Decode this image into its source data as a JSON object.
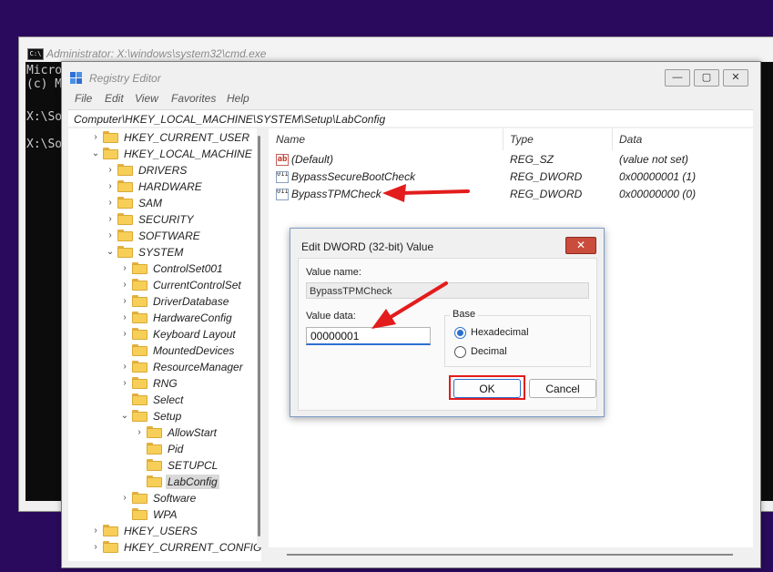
{
  "cmd": {
    "title": "Administrator: X:\\windows\\system32\\cmd.exe",
    "icon": "C:\\",
    "lines": [
      "Micro",
      "(c) M",
      "",
      "X:\\So",
      "",
      "X:\\So"
    ]
  },
  "regedit": {
    "title": "Registry Editor",
    "window_buttons": {
      "minimize": "—",
      "maximize": "▢",
      "close": "✕"
    },
    "menu": [
      "File",
      "Edit",
      "View",
      "Favorites",
      "Help"
    ],
    "address": "Computer\\HKEY_LOCAL_MACHINE\\SYSTEM\\Setup\\LabConfig",
    "tree": [
      {
        "label": "HKEY_CURRENT_USER",
        "arrow": "›"
      },
      {
        "label": "HKEY_LOCAL_MACHINE",
        "arrow": "⌄"
      },
      {
        "label": "DRIVERS",
        "arrow": "›"
      },
      {
        "label": "HARDWARE",
        "arrow": "›"
      },
      {
        "label": "SAM",
        "arrow": "›"
      },
      {
        "label": "SECURITY",
        "arrow": "›"
      },
      {
        "label": "SOFTWARE",
        "arrow": "›"
      },
      {
        "label": "SYSTEM",
        "arrow": "⌄"
      },
      {
        "label": "ControlSet001",
        "arrow": "›"
      },
      {
        "label": "CurrentControlSet",
        "arrow": "›"
      },
      {
        "label": "DriverDatabase",
        "arrow": "›"
      },
      {
        "label": "HardwareConfig",
        "arrow": "›"
      },
      {
        "label": "Keyboard Layout",
        "arrow": "›"
      },
      {
        "label": "MountedDevices",
        "arrow": ""
      },
      {
        "label": "ResourceManager",
        "arrow": "›"
      },
      {
        "label": "RNG",
        "arrow": "›"
      },
      {
        "label": "Select",
        "arrow": ""
      },
      {
        "label": "Setup",
        "arrow": "⌄"
      },
      {
        "label": "AllowStart",
        "arrow": "›"
      },
      {
        "label": "Pid",
        "arrow": ""
      },
      {
        "label": "SETUPCL",
        "arrow": ""
      },
      {
        "label": "LabConfig",
        "arrow": ""
      },
      {
        "label": "Software",
        "arrow": "›"
      },
      {
        "label": "WPA",
        "arrow": ""
      },
      {
        "label": "HKEY_USERS",
        "arrow": "›"
      },
      {
        "label": "HKEY_CURRENT_CONFIG",
        "arrow": "›"
      }
    ],
    "selected_key": "LabConfig",
    "columns": [
      "Name",
      "Type",
      "Data"
    ],
    "values": [
      {
        "icon": "ab",
        "name": "(Default)",
        "type": "REG_SZ",
        "data": "(value not set)"
      },
      {
        "icon": "011",
        "name": "BypassSecureBootCheck",
        "type": "REG_DWORD",
        "data": "0x00000001 (1)"
      },
      {
        "icon": "011",
        "name": "BypassTPMCheck",
        "type": "REG_DWORD",
        "data": "0x00000000 (0)"
      }
    ]
  },
  "dialog": {
    "title": "Edit DWORD (32-bit) Value",
    "close": "✕",
    "value_name_label": "Value name:",
    "value_name": "BypassTPMCheck",
    "value_data_label": "Value data:",
    "value_data": "00000001",
    "base_label": "Base",
    "base_options": [
      "Hexadecimal",
      "Decimal"
    ],
    "base_selected": "Hexadecimal",
    "ok": "OK",
    "cancel": "Cancel"
  },
  "annotations": {
    "arrow_color": "#e31c1c",
    "highlight_color": "#e31c1c"
  }
}
